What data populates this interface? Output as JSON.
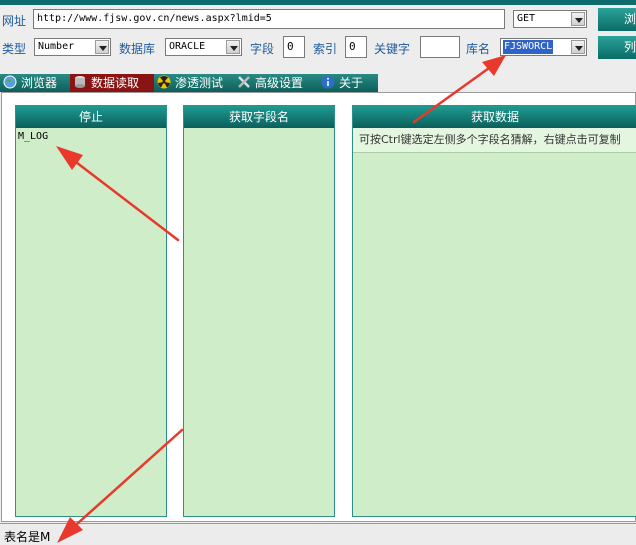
{
  "toolbar": {
    "url_label": "网址",
    "url_value": "http://www.fjsw.gov.cn/news.aspx?lmid=5",
    "method_value": "GET",
    "browse_button": "浏",
    "type_label": "类型",
    "type_value": "Number",
    "db_label": "数据库",
    "db_value": "ORACLE",
    "field_label": "字段",
    "field_value": "0",
    "index_label": "索引",
    "index_value": "0",
    "keyword_label": "关键字",
    "keyword_value": "",
    "dbname_label": "库名",
    "dbname_value": "FJSWORCL",
    "list_button": "列"
  },
  "tabs": [
    {
      "label": "浏览器",
      "icon": "globe-icon"
    },
    {
      "label": "数据读取",
      "icon": "database-icon"
    },
    {
      "label": "渗透测试",
      "icon": "radiation-icon"
    },
    {
      "label": "高级设置",
      "icon": "tools-icon"
    },
    {
      "label": "关于",
      "icon": "info-icon"
    }
  ],
  "panels": {
    "left_header": "停止",
    "left_items": [
      "M_LOG"
    ],
    "middle_header": "获取字段名",
    "right_header": "获取数据",
    "right_hint": "可按Ctrl键选定左侧多个字段名猜解，右键点击可复制"
  },
  "status": {
    "text": "表名是M"
  },
  "colors": {
    "teal": "#0e6b6b",
    "panel_green": "#ceedc8",
    "label_blue": "#1e5a9c",
    "active_tab": "#8a1414",
    "arrow_red": "#e8392c"
  }
}
